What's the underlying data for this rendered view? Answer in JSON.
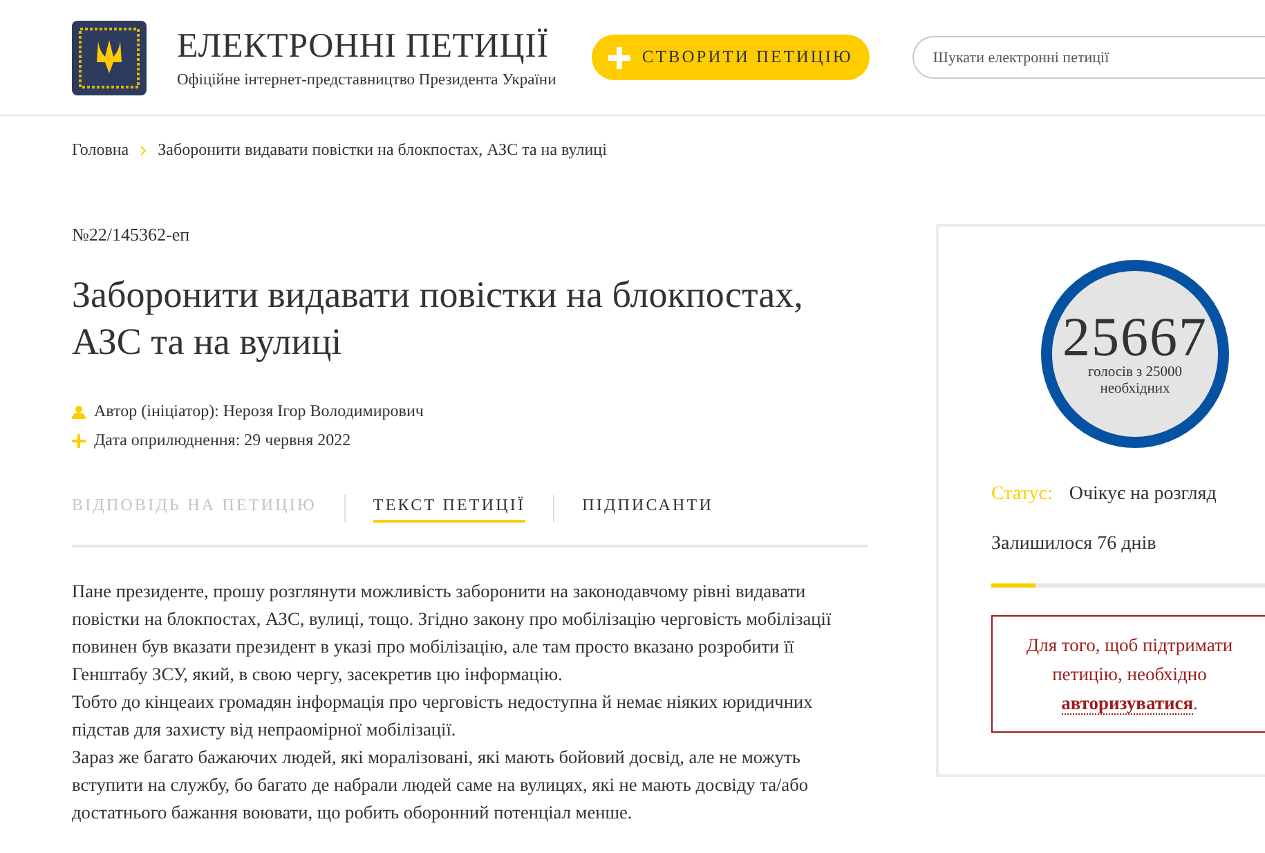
{
  "header": {
    "title": "ЕЛЕКТРОННІ ПЕТИЦІЇ",
    "subtitle": "Офіційне інтернет-представництво Президента України",
    "create_button": "СТВОРИТИ ПЕТИЦІЮ",
    "search": {
      "placeholder": "Шукати електронні петиції"
    }
  },
  "breadcrumb": [
    {
      "label": "Головна"
    },
    {
      "label": "Заборонити видавати повістки на блокпостах, АЗС та на вулиці"
    }
  ],
  "petition": {
    "number": "№22/145362-еп",
    "title": "Заборонити видавати повістки на блокпостах, АЗС та на вулиці",
    "meta": [
      {
        "kind": "author",
        "text": "Автор (ініціатор): Нерозя Ігор Володимирович"
      },
      {
        "kind": "date",
        "text": "Дата оприлюднення: 29 червня 2022"
      }
    ],
    "tabs": [
      {
        "label": "ВІДПОВІДЬ НА ПЕТИЦІЮ",
        "selected": false,
        "disabled": true
      },
      {
        "label": "ТЕКСТ ПЕТИЦІЇ",
        "selected": true,
        "disabled": false
      },
      {
        "label": "ПІДПИСАНТИ",
        "selected": false,
        "disabled": false
      }
    ],
    "paragraphs": [
      "Пане президенте, прошу розглянути можливість заборонити на законодавчому рівні видавати повістки на блокпостах, АЗС, вулиці, тощо. Згідно закону про мобілізацію черговість мобілізації повинен був вказати президент в указі про мобілізацію, але там просто вказано розробити її Генштабу ЗСУ, який, в свою чергу, засекретив цю інформацію.",
      "Тобто до кінцеаих громадян інформація про черговість недоступна й немає ніяких юридичних підстав для захисту від непраомірної мобілізації.",
      "Зараз же багато бажаючих людей, які моралізовані, які мають бойовий досвід, але не можуть вступити на службу, бо багато де набрали людей саме на вулицях, які не мають досвіду та/або достатнього бажання воювати, що робить оборонний потенціал менше."
    ]
  },
  "sidebar": {
    "votes": "25667",
    "votes_caption": "голосів з 25000 необхідних",
    "status_label": "Статус:",
    "status_value": "Очікує на розгляд",
    "days_left": "Залишилося 76 днів",
    "days_progress": {
      "level": 0.16
    },
    "auth_notice": {
      "text": "Для того, щоб підтримати петицію, необхідно ",
      "link": "авторизуватися",
      "after": "."
    }
  }
}
